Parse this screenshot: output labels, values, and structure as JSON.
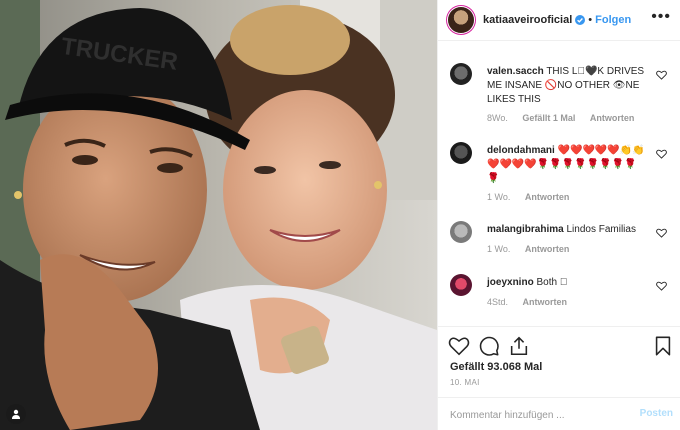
{
  "header": {
    "username": "katiaaveirooficial",
    "dot": "•",
    "follow_label": "Folgen",
    "more_label": "•••"
  },
  "photo": {
    "cap_text": "TRUCKER"
  },
  "comments": [
    {
      "username": "valen.sacch",
      "text": "THIS L🏽🖤K DRIVES ME INSANE 🚫NO OTHER 👁NE LIKES THIS",
      "time": "8Wo.",
      "likes": "Gefällt 1 Mal",
      "reply": "Antworten"
    },
    {
      "username": "delondahmani",
      "text": "❤️❤️❤️❤️❤️👏👏❤️❤️❤️❤️🌹🌹🌹🌹🌹🌹🌹🌹🌹",
      "time": "1 Wo.",
      "reply": "Antworten"
    },
    {
      "username": "malangibrahima",
      "text": "Lindos Familias",
      "time": "1 Wo.",
      "reply": "Antworten"
    },
    {
      "username": "joeyxnino",
      "text": "Both 🏻",
      "time": "4Std.",
      "reply": "Antworten"
    }
  ],
  "likes_text": "Gefällt 93.068 Mal",
  "date_text": "10. MAI",
  "composer": {
    "placeholder": "Kommentar hinzufügen ...",
    "post_label": "Posten"
  },
  "colors": {
    "link_blue": "#3897f0",
    "post_disabled": "#b2dffc",
    "text": "#262626",
    "meta": "#999999"
  },
  "icons": [
    "user-tag-icon",
    "verified-badge-icon",
    "more-options-icon",
    "heart-icon",
    "comment-icon",
    "share-icon",
    "bookmark-icon"
  ]
}
